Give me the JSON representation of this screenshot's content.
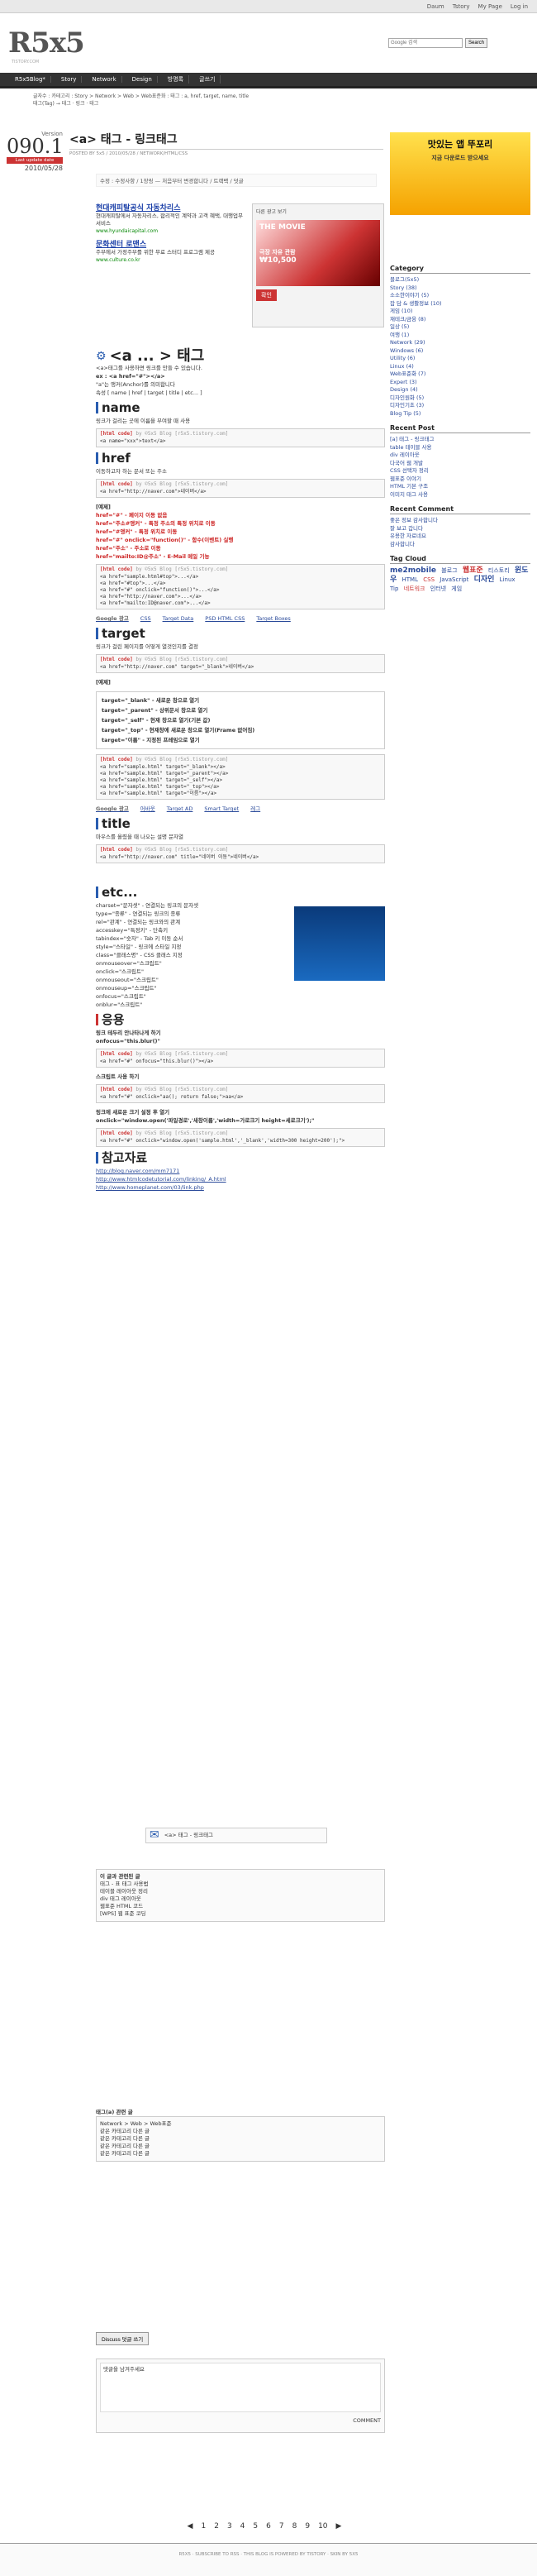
{
  "topbar": {
    "links": [
      "Daum",
      "Tstory",
      "My Page",
      "Log in"
    ]
  },
  "logo": {
    "text": "R5x5",
    "sub": "TISTORY.COM"
  },
  "search": {
    "placeholder": "Google 검색",
    "button": "Search"
  },
  "nav": {
    "items": [
      "R5x5Blog*",
      "Story",
      "Network",
      "Design",
      "방명록",
      "글쓰기"
    ]
  },
  "crumb": {
    "text": "글자수 : 카테고리 : Story > Network > Web > Web표준화 : 태그 : a, href, target, name, title",
    "tags": "태그(Tag) → 태그 · 링크 · 태그"
  },
  "date": {
    "version": "Version",
    "num": "090.1",
    "updated": "Last update date",
    "value": "2010/05/28"
  },
  "post": {
    "title": "<a> 태그 - 링크태그",
    "meta": "POSTED BY 5x5 / 2010/05/28 / NETWORK/HTML/CSS"
  },
  "tags_line": "수정 : 수정사항 / 1장링 — 처음부터 변경합니다 / 트랙백 / 덧글",
  "ad1": {
    "h1": "현대캐피탈공식 자동차리스",
    "d1": "현대캐피탈에서 자동차리스, 합리적인 계약과 고객 혜택, 대행업무 서비스",
    "u1": "www.hyundaicapital.com",
    "h2": "문화센터 로맨스",
    "d2": "주부에서 가정주부를 위한 무료 스터디 프로그램 제공",
    "u2": "www.culture.co.kr",
    "google": "Google 광고"
  },
  "adbox": {
    "top": "다른 광고 보기",
    "brand": "THE MOVIE",
    "sub": "극장 자유 관람",
    "price": "₩10,500",
    "ok": "확인"
  },
  "content": {
    "h_main": "<a ... > 태그",
    "intro1": "<a>태그를 사용하면 링크를 만들 수 있습니다.",
    "ex": "ex : <a href=\"#\"></a>",
    "intro2": "\"a\"는 앵커(Anchor)를 의미합니다",
    "attrs": "속성 [ name | href | target | title | etc... ]",
    "s_name": "name",
    "name_desc": "링크가 걸리는 곳에 이름을 부여할 때 사용",
    "code_head": "[html code]",
    "code_by": "by ©5x5 Blog [r5x5.tistory.com]",
    "name_code": "<a name=\"xxx\">text</a>",
    "s_href": "href",
    "href_desc": "이동하고자 하는 문서 또는 주소",
    "href_code": "<a href=\"http://naver.com\">네이버</a>",
    "ex_label": "[예제]",
    "href_items": [
      "href=\"#\" - 페이지 이동 없음",
      "href=\"주소#앵커\" - 특정 주소의 특정 위치로 이동",
      "href=\"#앵커\" - 특정 위치로 이동",
      "href=\"#\" onclick=\"function()\" - 함수(이벤트) 실행",
      "href=\"주소\" - 주소로 이동",
      "href=\"mailto:ID@주소\" - E-Mail 메일 기능"
    ],
    "href_ex": [
      "<a href=\"sample.html#top\">...</a>",
      "<a href=\"#top\">...</a>",
      "<a href=\"#\" onclick=\"function()\">...</a>",
      "<a href=\"http://naver.com\">...</a>",
      "<a href=\"mailto:ID@naver.com\">...</a>"
    ],
    "gads1": [
      "Google 광고",
      "CSS",
      "Target Data",
      "PSD HTML CSS",
      "Target Boxes"
    ],
    "s_target": "target",
    "target_desc": "링크가 걸린 페이지를 어떻게 열것인지를 결정",
    "target_code": "<a href=\"http://naver.com\" target=\"_blank\">네이버</a>",
    "target_items": [
      "target=\"_blank\" - 새로운 창으로 열기",
      "target=\"_parent\" - 상위문서 창으로 열기",
      "target=\"_self\" - 현재 창으로 열기(기본 값)",
      "target=\"_top\" - 현재창에 새로운 창으로 열기(Frame 없어짐)",
      "target=\"이름\" - 지정된 프레임으로 열기"
    ],
    "target_ex": [
      "<a href=\"sample.html\" target=\"_blank\"></a>",
      "<a href=\"sample.html\" target=\"_parent\"></a>",
      "<a href=\"sample.html\" target=\"_self\"></a>",
      "<a href=\"sample.html\" target=\"_top\"></a>",
      "<a href=\"sample.html\" target=\"이름\"></a>"
    ],
    "gads2": [
      "Google 광고",
      "어바웃",
      "Target AD",
      "Smart Target",
      "레그"
    ],
    "s_title": "title",
    "title_desc": "마우스를 올렸을 때 나오는 설명 문자열",
    "title_code": "<a href=\"http://naver.com\" title=\"네이버 이동\">네이버</a>",
    "s_etc": "etc...",
    "etc_items": [
      "charset=\"문자셋\" - 연결되는 링크의 문자셋",
      "type=\"종류\" - 연결되는 링크의 종류",
      "rel=\"관계\" - 연결되는 링크와의 관계",
      "accesskey=\"특정키\" - 단축키",
      "tabindex=\"숫자\" - Tab 키 이동 순서",
      "style=\"스타일\" - 링크에 스타일 지정",
      "class=\"클래스명\" - CSS 클래스 지정",
      "onmouseover=\"스크립트\"",
      "onclick=\"스크립트\"",
      "onmouseout=\"스크립트\"",
      "onmouseup=\"스크립트\"",
      "onfocus=\"스크립트\"",
      "onblur=\"스크립트\""
    ],
    "s_apply": "응용",
    "apply1": "링크 테두리 안나타나게 하기",
    "apply1_code": "onfocus=\"this.blur()\"",
    "apply1_ex": "<a href=\"#\" onfocus=\"this.blur()\"></a>",
    "apply2": "스크립트 사용 하기",
    "apply2_ex": "<a href=\"#\" onclick=\"aa(); return false;\">aa</a>",
    "apply3": "링크에 새로운 크기 설정 후 열기",
    "apply3_code": "onclick=\"window.open('파일경로','새창이름','width=가로크기 height=세로크기');\"",
    "apply3_ex": "<a href=\"#\" onclick=\"window.open('sample.html','_blank','width=300 height=200');\">",
    "s_ref": "참고자료",
    "refs": [
      "http://blog.naver.com/mm7171",
      "http://www.htmlcodetutorial.com/linking/_A.html",
      "http://www.homeplanet.com/03/link.php"
    ]
  },
  "sidebar": {
    "ad": "맛있는 앱 뚜포리",
    "ad_sub": "지금 다운로드 받으세요",
    "cat_title": "Category",
    "categories": [
      "블로그(5x5)",
      "Story (38)",
      "소소한이야기 (5)",
      "잡 담 & 생활정보 (10)",
      "게임 (10)",
      "재테크/금융 (8)",
      "일상 (5)",
      "여행 (1)",
      "Network (29)",
      "Windows (6)",
      "Utility (6)",
      "Linux (4)",
      "Web표준화 (7)",
      "Expert (3)",
      "Design (4)",
      "디자인원화 (5)",
      "디자인기초 (3)",
      "Blog Tip (5)"
    ],
    "recent_title": "Recent Post",
    "recent": [
      "[a] 태그 - 링크태그",
      "table 테이블 사용",
      "div 레이아웃",
      "다국어 웹 개발",
      "CSS 선택자 정리",
      "웹표준 이야기",
      "HTML 기본 구조",
      "이미지 태그 사용"
    ],
    "comment_title": "Recent Comment",
    "comments": [
      "좋은 정보 감사합니다",
      "잘 보고 갑니다",
      "유용한 자료네요",
      "감사합니다"
    ],
    "tag_title": "Tag Cloud",
    "tags": [
      "me2mobile",
      "블로그",
      "웹표준",
      "티스토리",
      "윈도우",
      "HTML",
      "CSS",
      "JavaScript",
      "디자인",
      "Linux",
      "Tip",
      "네트워크",
      "인터넷",
      "게임"
    ]
  },
  "lower": {
    "share": "<a> 태그 - 링크태그",
    "related_title": "이 글과 관련된 글",
    "related": [
      "태그 - 표 태그 사용법",
      "테이블 레이아웃 정리",
      "div 태그 레이아웃",
      "웹표준 HTML 코드",
      "[WPS] 웹 표준 코딩"
    ],
    "trackback_title": "태그(a) 관련 글",
    "trackbacks": [
      "Network > Web > Web표준",
      "같은 카테고리 다른 글",
      "같은 카테고리 다른 글",
      "같은 카테고리 다른 글",
      "같은 카테고리 다른 글"
    ],
    "comment_btn": "Discuss 덧글 쓰기",
    "comment_placeholder": "댓글을 남겨주세요",
    "submit": "COMMENT"
  },
  "pager": [
    "◀",
    "1",
    "2",
    "3",
    "4",
    "5",
    "6",
    "7",
    "8",
    "9",
    "10",
    "▶"
  ],
  "footer": "R5X5 · SUBSCRIBE TO RSS · THIS BLOG IS POWERED BY TISTORY · SKIN BY 5X5"
}
